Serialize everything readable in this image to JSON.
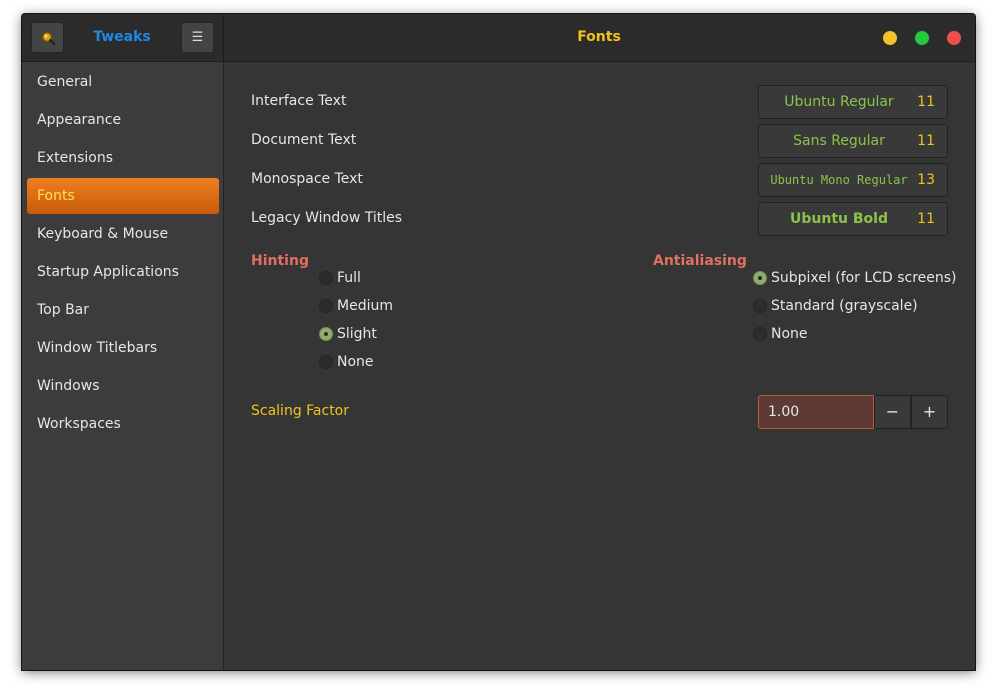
{
  "app": {
    "title": "Tweaks",
    "page_title": "Fonts",
    "menu_icon_glyph": "☰"
  },
  "sidebar": {
    "items": [
      {
        "label": "General"
      },
      {
        "label": "Appearance"
      },
      {
        "label": "Extensions"
      },
      {
        "label": "Fonts",
        "active": true
      },
      {
        "label": "Keyboard & Mouse"
      },
      {
        "label": "Startup Applications"
      },
      {
        "label": "Top Bar"
      },
      {
        "label": "Window Titlebars"
      },
      {
        "label": "Windows"
      },
      {
        "label": "Workspaces"
      }
    ]
  },
  "fonts": {
    "rows": [
      {
        "label": "Interface Text",
        "font": "Ubuntu Regular",
        "size": "11"
      },
      {
        "label": "Document Text",
        "font": "Sans Regular",
        "size": "11"
      },
      {
        "label": "Monospace Text",
        "font": "Ubuntu Mono Regular",
        "size": "13"
      },
      {
        "label": "Legacy Window Titles",
        "font": "Ubuntu Bold",
        "size": "11"
      }
    ]
  },
  "hinting": {
    "label": "Hinting",
    "options": [
      "Full",
      "Medium",
      "Slight",
      "None"
    ],
    "selected": "Slight"
  },
  "antialiasing": {
    "label": "Antialiasing",
    "options": [
      "Subpixel (for LCD screens)",
      "Standard (grayscale)",
      "None"
    ],
    "selected": "Subpixel (for LCD screens)"
  },
  "scaling": {
    "label": "Scaling Factor",
    "value": "1.00",
    "minus": "−",
    "plus": "+"
  },
  "colors": {
    "accent_orange": "#f07f1f",
    "title_yellow": "#f0c419",
    "app_title_blue": "#1e88e5",
    "font_green": "#8bc34a",
    "section_red": "#e0705f"
  },
  "icons": {
    "search": "search-icon",
    "menu": "hamburger-menu-icon",
    "minimize": "minimize-icon",
    "maximize": "maximize-icon",
    "close": "close-icon"
  }
}
